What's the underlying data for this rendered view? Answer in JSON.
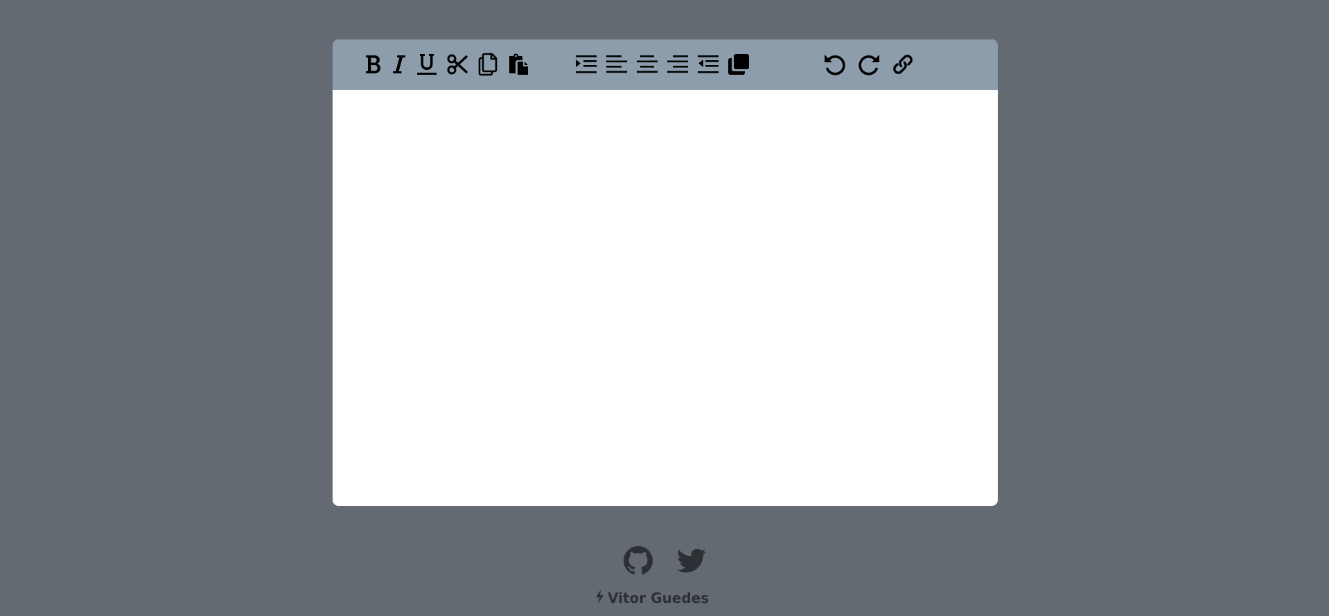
{
  "toolbar": {
    "buttons": [
      {
        "name": "bold",
        "icon": "bold-icon"
      },
      {
        "name": "italic",
        "icon": "italic-icon"
      },
      {
        "name": "underline",
        "icon": "underline-icon"
      },
      {
        "name": "cut",
        "icon": "scissors-icon"
      },
      {
        "name": "copy",
        "icon": "copy-icon"
      },
      {
        "name": "paste",
        "icon": "paste-icon"
      },
      {
        "name": "indent",
        "icon": "indent-icon"
      },
      {
        "name": "align-left",
        "icon": "align-left-icon"
      },
      {
        "name": "align-center",
        "icon": "align-center-icon"
      },
      {
        "name": "align-right",
        "icon": "align-right-icon"
      },
      {
        "name": "outdent",
        "icon": "outdent-icon"
      },
      {
        "name": "clone",
        "icon": "clone-icon"
      },
      {
        "name": "undo",
        "icon": "undo-icon"
      },
      {
        "name": "redo",
        "icon": "redo-icon"
      },
      {
        "name": "link",
        "icon": "link-icon"
      }
    ]
  },
  "editor": {
    "content": ""
  },
  "footer": {
    "author": "Vitor Guedes",
    "github_icon": "github-icon",
    "twitter_icon": "twitter-icon",
    "bolt_icon": "bolt-icon"
  },
  "colors": {
    "page_background": "#646a72",
    "toolbar_background": "#8d9dac",
    "editor_background": "#ffffff",
    "icon_color": "#000000",
    "footer_text": "#2c2f33"
  }
}
